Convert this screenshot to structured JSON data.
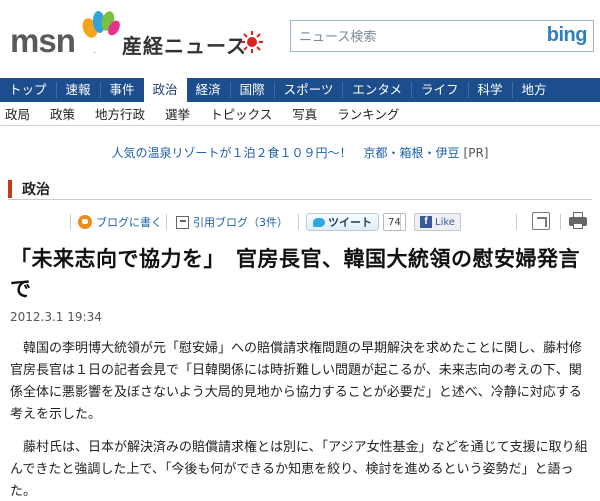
{
  "header": {
    "logo_msn": "msn",
    "logo_dot": ".",
    "logo_sankei": "産経ニュース",
    "search_placeholder": "ニュース検索",
    "search_engine": "bing"
  },
  "main_nav": {
    "items": [
      {
        "label": "トップ"
      },
      {
        "label": "速報"
      },
      {
        "label": "事件"
      },
      {
        "label": "政治",
        "active": true
      },
      {
        "label": "経済"
      },
      {
        "label": "国際"
      },
      {
        "label": "スポーツ"
      },
      {
        "label": "エンタメ"
      },
      {
        "label": "ライフ"
      },
      {
        "label": "科学"
      },
      {
        "label": "地方"
      }
    ]
  },
  "sub_nav": {
    "items": [
      {
        "label": "政局"
      },
      {
        "label": "政策",
        "active": true
      },
      {
        "label": "地方行政"
      },
      {
        "label": "選挙"
      },
      {
        "label": "トピックス"
      },
      {
        "label": "写真"
      },
      {
        "label": "ランキング"
      }
    ]
  },
  "ad": {
    "text": "人気の温泉リゾートが１泊２食１０９円〜！",
    "text2": "京都・箱根・伊豆",
    "tag": "[PR]"
  },
  "section": {
    "title": "政治"
  },
  "toolbar": {
    "blog_write": "ブログに書く",
    "quote_blog": "引用ブログ（3件）",
    "tweet": "ツイート",
    "tweet_count": "74",
    "like": "Like"
  },
  "article": {
    "headline": "「未来志向で協力を」　官房長官、韓国大統領の慰安婦発言で",
    "date": "2012.3.1 19:34",
    "para1": "　韓国の李明博大統領が元「慰安婦」への賠償請求権問題の早期解決を求めたことに関し、藤村修官房長官は１日の記者会見で「日韓関係には時折難しい問題が起こるが、未来志向の考えの下、関係全体に悪影響を及ぼさないよう大局的見地から協力することが必要だ」と述べ、冷静に対応する考えを示した。",
    "para2": "　藤村氏は、日本が解決済みの賠償請求権とは別に、「アジア女性基金」などを通じて支援に取り組んできたと強調した上で、「今後も何ができるか知恵を絞り、検討を進めるという姿勢だ」と語った。"
  },
  "colors": {
    "nav_bg": "#1c4d8c",
    "section_accent": "#c8381e",
    "link": "#1d5fa8"
  }
}
